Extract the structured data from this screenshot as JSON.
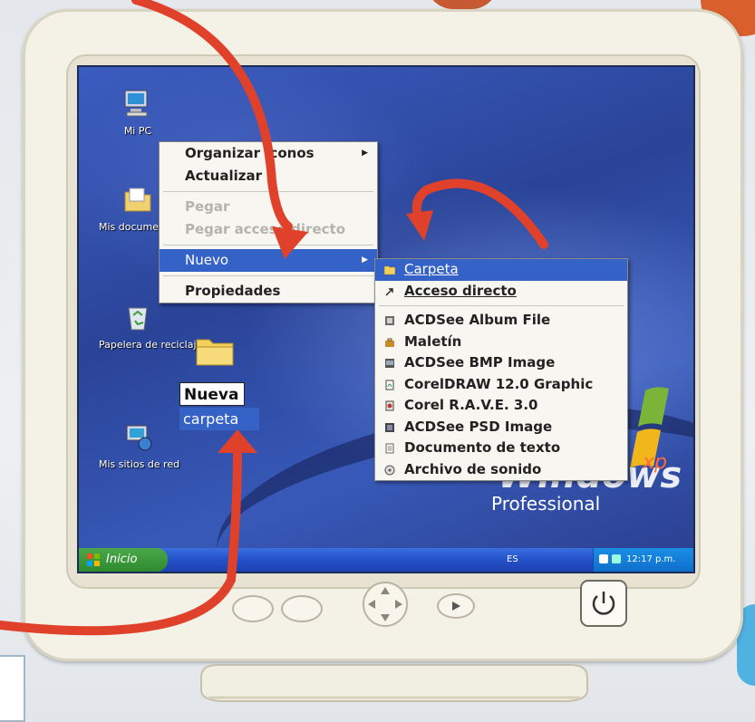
{
  "desktop": {
    "icons": [
      {
        "label": "Mi PC",
        "icon": "my-computer-icon"
      },
      {
        "label": "Mis documentos",
        "icon": "my-documents-icon"
      },
      {
        "label": "Papelera de reciclaje",
        "icon": "recycle-bin-icon"
      },
      {
        "label": "Mis sitios de red",
        "icon": "network-places-icon"
      }
    ],
    "new_folder": {
      "line1": "Nueva",
      "line2": "carpeta",
      "icon": "folder-icon"
    }
  },
  "context_menu": {
    "items": [
      {
        "label": "Organizar iconos",
        "enabled": true,
        "submenu": true
      },
      {
        "label": "Actualizar",
        "enabled": true,
        "submenu": false
      },
      {
        "label": "Pegar",
        "enabled": false,
        "submenu": false
      },
      {
        "label": "Pegar acceso directo",
        "enabled": false,
        "submenu": false
      },
      {
        "label": "Nuevo",
        "enabled": true,
        "submenu": true,
        "highlighted": true
      },
      {
        "label": "Propiedades",
        "enabled": true,
        "submenu": false
      }
    ]
  },
  "submenu_nuevo": {
    "items": [
      {
        "label": "Carpeta",
        "icon": "folder-icon",
        "highlighted": true
      },
      {
        "label": "Acceso directo",
        "icon": "shortcut-icon"
      },
      {
        "label": "ACDSee Album File",
        "icon": "album-file-icon"
      },
      {
        "label": "Maletín",
        "icon": "briefcase-icon"
      },
      {
        "label": "ACDSee BMP Image",
        "icon": "bmp-image-icon"
      },
      {
        "label": "CorelDRAW 12.0 Graphic",
        "icon": "coreldraw-icon"
      },
      {
        "label": "Corel R.A.V.E. 3.0",
        "icon": "corel-rave-icon"
      },
      {
        "label": "ACDSee PSD Image",
        "icon": "psd-image-icon"
      },
      {
        "label": "Documento de texto",
        "icon": "text-document-icon"
      },
      {
        "label": "Archivo de sonido",
        "icon": "sound-file-icon"
      }
    ]
  },
  "wallpaper": {
    "brand_word": "Windows",
    "brand_suffix": "xp",
    "edition": "Professional"
  },
  "taskbar": {
    "start_label": "Inicio",
    "lang": "ES",
    "clock": "12:17 p.m."
  },
  "colors": {
    "highlight": "#3562c7",
    "desktop": "#2c4aa0",
    "annotation_arrow": "#e0412a",
    "start_green": "#3a9a3a"
  }
}
